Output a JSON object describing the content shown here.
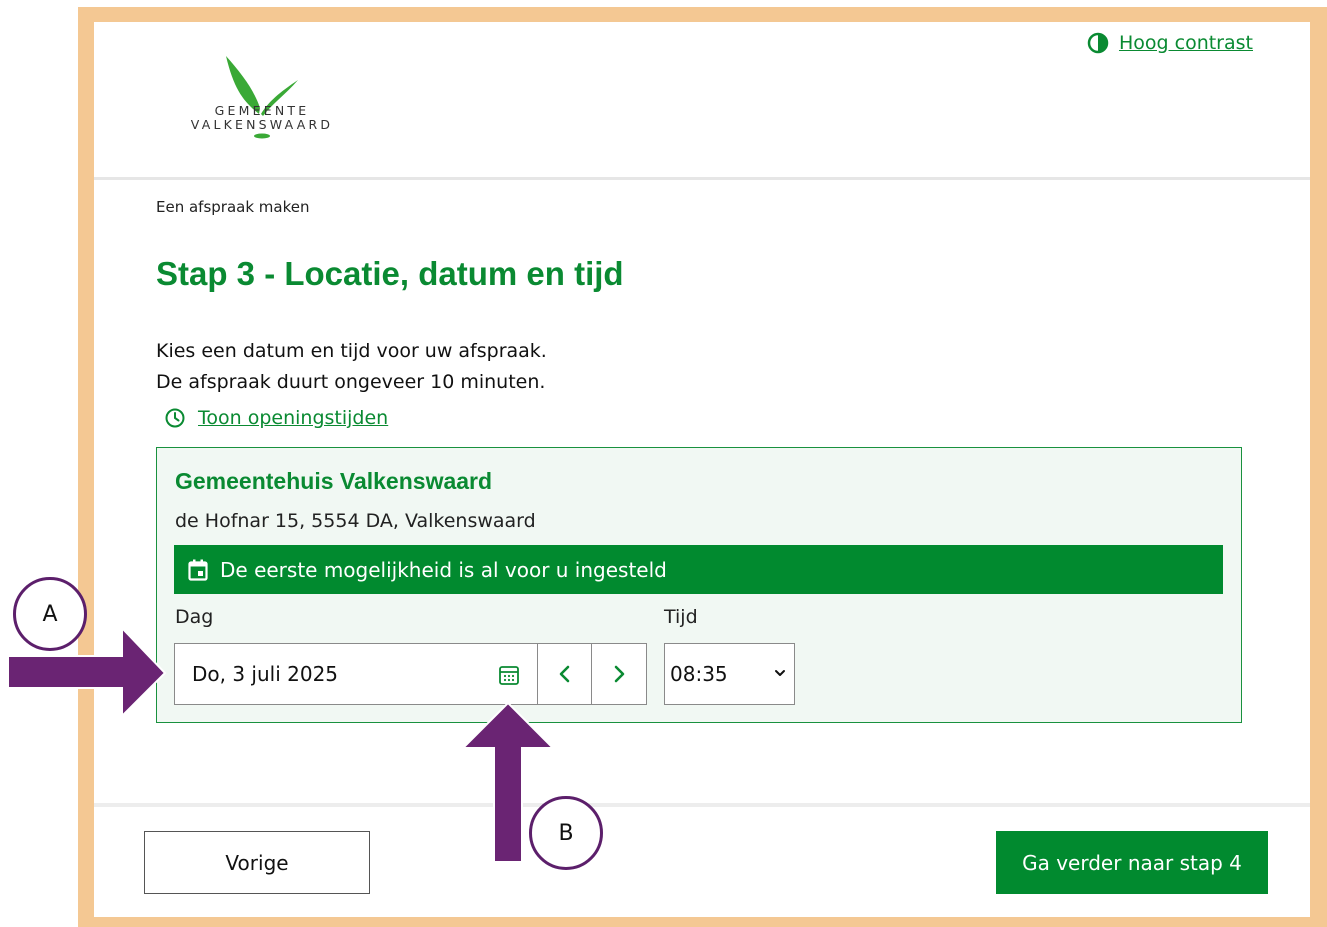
{
  "header": {
    "logo_line1": "GEMEENTE",
    "logo_line2": "VALKENSWAARD",
    "high_contrast_label": "Hoog contrast"
  },
  "breadcrumb": "Een afspraak maken",
  "page_title": "Stap 3 - Locatie, datum en tijd",
  "intro": {
    "line1": "Kies een datum en tijd voor uw afspraak.",
    "line2": "De afspraak duurt ongeveer 10 minuten."
  },
  "opening_hours_link": "Toon openingstijden",
  "location": {
    "name": "Gemeentehuis Valkenswaard",
    "address": "de Hofnar 15, 5554 DA, Valkenswaard",
    "notice": "De eerste mogelijkheid is al voor u ingesteld",
    "day_label": "Dag",
    "day_value": "Do, 3 juli 2025",
    "time_label": "Tijd",
    "time_value": "08:35"
  },
  "footer": {
    "prev_label": "Vorige",
    "next_label": "Ga verder naar stap 4"
  },
  "annotations": {
    "a_label": "A",
    "b_label": "B"
  },
  "colors": {
    "brand_green": "#0a8a32",
    "notice_green": "#018a2f",
    "frame": "#f4c893",
    "arrow_purple": "#6a2473"
  },
  "icons": [
    "contrast-icon",
    "clock-icon",
    "calendar-icon",
    "chevron-left-icon",
    "chevron-right-icon",
    "chevron-down-icon"
  ]
}
